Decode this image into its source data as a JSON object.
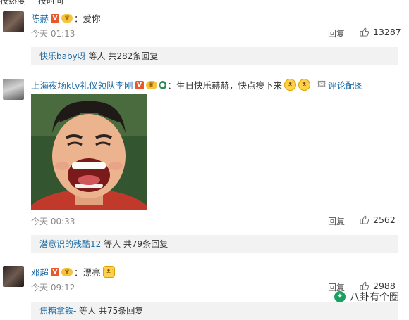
{
  "top_partial": [
    "按热度",
    "按时间"
  ],
  "labels": {
    "reply": "回复",
    "pic_comment": "评论配图"
  },
  "comments": [
    {
      "user": "陈赫",
      "text": "：爱你",
      "time": "今天 01:13",
      "likes": "13287",
      "sub": {
        "user": "快乐baby呀",
        "summary": "等人 共282条回复"
      }
    },
    {
      "user": "上海夜场ktv礼仪领队李刚",
      "text": "：生日快乐赫赫，快点瘦下来",
      "time": "今天 00:33",
      "likes": "2562",
      "sub": {
        "user": "潜意识的残酷12",
        "summary": "等人 共79条回复"
      }
    },
    {
      "user": "邓超",
      "text": "：漂亮",
      "time": "今天 09:12",
      "likes": "2988",
      "sub": {
        "user": "焦糖拿铁-",
        "summary": "等人 共75条回复"
      }
    }
  ],
  "watermark": "八卦有个圈",
  "colors": {
    "link": "#1b6aa5",
    "muted": "#888888",
    "vip": "#e9572c",
    "subbg": "#f2f2f2"
  }
}
